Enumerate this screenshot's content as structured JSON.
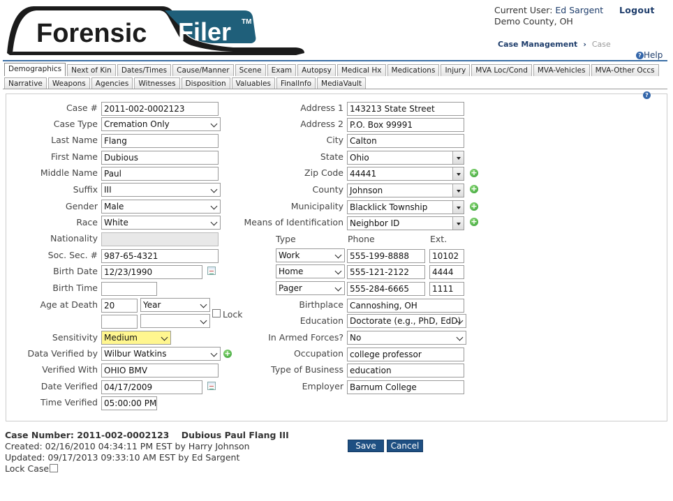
{
  "app": {
    "logo_text": "Forensic Filer",
    "logo_tm": "TM"
  },
  "header": {
    "current_user_label": "Current User:",
    "current_user": "Ed Sargent",
    "logout": "Logout",
    "county": "Demo County, OH",
    "breadcrumb": [
      "Case Management",
      "Case"
    ],
    "help": "Help"
  },
  "tabs_row1": [
    "Demographics",
    "Next of Kin",
    "Dates/Times",
    "Cause/Manner",
    "Scene",
    "Exam",
    "Autopsy",
    "Medical Hx",
    "Medications",
    "Injury",
    "MVA Loc/Cond",
    "MVA-Vehicles",
    "MVA-Other Occs"
  ],
  "tabs_row2": [
    "Narrative",
    "Weapons",
    "Agencies",
    "Witnesses",
    "Disposition",
    "Valuables",
    "FinalInfo",
    "MediaVault"
  ],
  "active_tab": "Demographics",
  "left": {
    "case_no_label": "Case #",
    "case_no": "2011-002-0002123",
    "case_type_label": "Case Type",
    "case_type": "Cremation Only",
    "last_name_label": "Last Name",
    "last_name": "Flang",
    "first_name_label": "First Name",
    "first_name": "Dubious",
    "middle_name_label": "Middle Name",
    "middle_name": "Paul",
    "suffix_label": "Suffix",
    "suffix": "III",
    "gender_label": "Gender",
    "gender": "Male",
    "race_label": "Race",
    "race": "White",
    "nationality_label": "Nationality",
    "nationality": "",
    "ssn_label": "Soc. Sec. #",
    "ssn": "987-65-4321",
    "birth_date_label": "Birth Date",
    "birth_date": "12/23/1990",
    "birth_time_label": "Birth Time",
    "birth_time": "",
    "age_label": "Age at Death",
    "age": "20",
    "age_unit": "Year",
    "age2": "",
    "age_unit2": "",
    "lock_label": "Lock",
    "sensitivity_label": "Sensitivity",
    "sensitivity": "Medium",
    "verified_by_label": "Data Verified by",
    "verified_by": "Wilbur Watkins",
    "verified_with_label": "Verified With",
    "verified_with": "OHIO BMV",
    "date_verified_label": "Date Verified",
    "date_verified": "04/17/2009",
    "time_verified_label": "Time Verified",
    "time_verified": "05:00:00 PM"
  },
  "right": {
    "address1_label": "Address 1",
    "address1": "143213 State Street",
    "address2_label": "Address 2",
    "address2": "P.O. Box 99991",
    "city_label": "City",
    "city": "Calton",
    "state_label": "State",
    "state": "Ohio",
    "zip_label": "Zip Code",
    "zip": "44441",
    "county_label": "County",
    "county": "Johnson",
    "municipality_label": "Municipality",
    "municipality": "Blacklick Township",
    "means_id_label": "Means of Identification",
    "means_id": "Neighbor ID",
    "type_header": "Type",
    "phone_header": "Phone",
    "ext_header": "Ext.",
    "phones": [
      {
        "type": "Work",
        "phone": "555-199-8888",
        "ext": "10102"
      },
      {
        "type": "Home",
        "phone": "555-121-2122",
        "ext": "4444"
      },
      {
        "type": "Pager",
        "phone": "555-284-6665",
        "ext": "1111"
      }
    ],
    "birthplace_label": "Birthplace",
    "birthplace": "Cannoshing, OH",
    "education_label": "Education",
    "education": "Doctorate (e.g., PhD, EdD)",
    "armed_label": "In Armed Forces?",
    "armed": "No",
    "occupation_label": "Occupation",
    "occupation": "college professor",
    "business_label": "Type of Business",
    "business": "education",
    "employer_label": "Employer",
    "employer": "Barnum College"
  },
  "footer": {
    "case_number_label": "Case Number:",
    "case_number": "2011-002-0002123",
    "case_name": "Dubious Paul Flang III",
    "created": "Created: 02/16/2010 04:34:11 PM EST by Harry Johnson",
    "updated": "Updated: 09/17/2013 09:33:10 AM EST by Ed Sargent",
    "lock_case": "Lock Case",
    "save": "Save",
    "cancel": "Cancel"
  },
  "colors": {
    "brand": "#1e3d6b",
    "accent": "#3a6ea5",
    "highlight": "#fff68f",
    "button": "#1e4f82"
  },
  "icons": [
    "help-icon",
    "add-icon",
    "calendar-icon",
    "chevron-down-icon"
  ]
}
